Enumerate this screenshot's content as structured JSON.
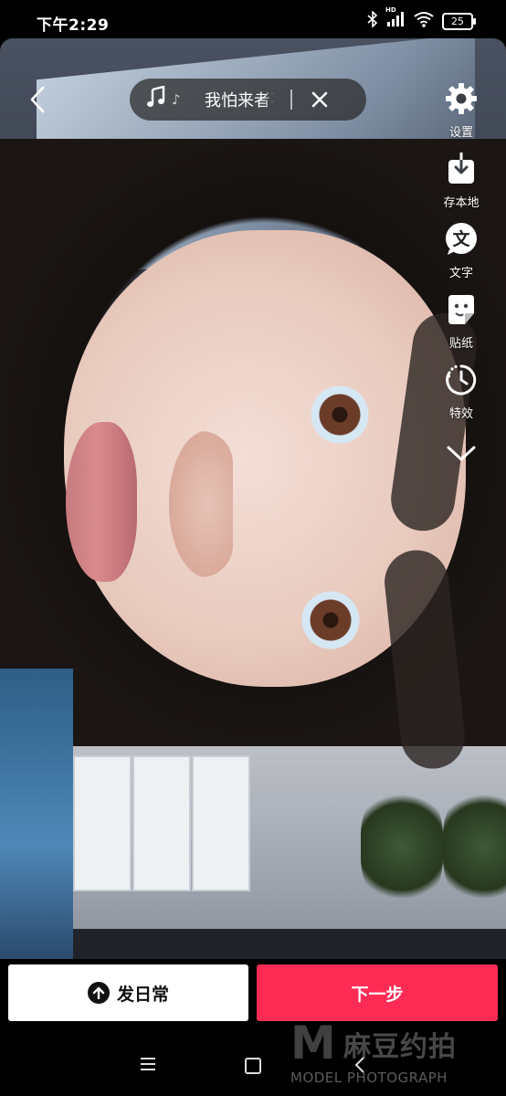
{
  "status_bar": {
    "time": "下午2:29",
    "network_label": "HD",
    "battery": "25",
    "icons": [
      "bluetooth-icon",
      "signal-icon",
      "wifi-icon",
      "battery-icon"
    ]
  },
  "music": {
    "title": "我怕来者不",
    "icons": [
      "music-note-icon",
      "close-icon"
    ]
  },
  "tools": [
    {
      "label": "设置",
      "icon": "gear-icon"
    },
    {
      "label": "存本地",
      "icon": "download-icon"
    },
    {
      "label": "文字",
      "icon": "text-icon"
    },
    {
      "label": "贴纸",
      "icon": "sticker-icon"
    },
    {
      "label": "特效",
      "icon": "effects-timer-icon"
    }
  ],
  "buttons": {
    "daily_label": "发日常",
    "next_label": "下一步"
  },
  "watermark": {
    "mark": "M",
    "chinese": "麻豆约拍",
    "english": "MODEL PHOTOGRAPH"
  },
  "colors": {
    "accent": "#fe2c55",
    "bar_bg": "#000000"
  }
}
